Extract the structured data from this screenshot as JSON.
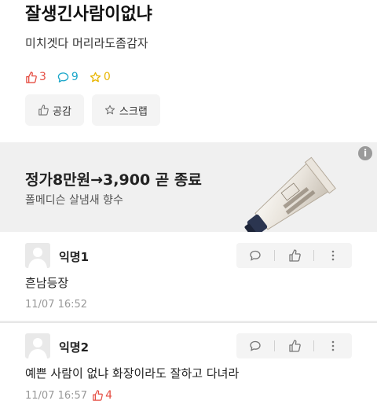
{
  "post": {
    "title": "잘생긴사람이없냐",
    "body": "미치겟다 머리라도좀감자",
    "likes": "3",
    "comments": "9",
    "scraps": "0",
    "empathy_label": "공감",
    "scrap_label": "스크랩"
  },
  "ad": {
    "title": "정가8만원→3,900 곧 종료",
    "subtitle": "폴메디슨 살냄새 향수",
    "info": "i"
  },
  "comments": [
    {
      "author": "익명1",
      "text": "흔남등장",
      "time": "11/07 16:52",
      "likes": ""
    },
    {
      "author": "익명2",
      "text": "예쁜 사람이 없냐 화장이라도 잘하고 다녀라",
      "time": "11/07 16:57",
      "likes": "4"
    }
  ],
  "colors": {
    "like": "#e54d42",
    "comment": "#1aa6c9",
    "scrap": "#e8b500"
  }
}
